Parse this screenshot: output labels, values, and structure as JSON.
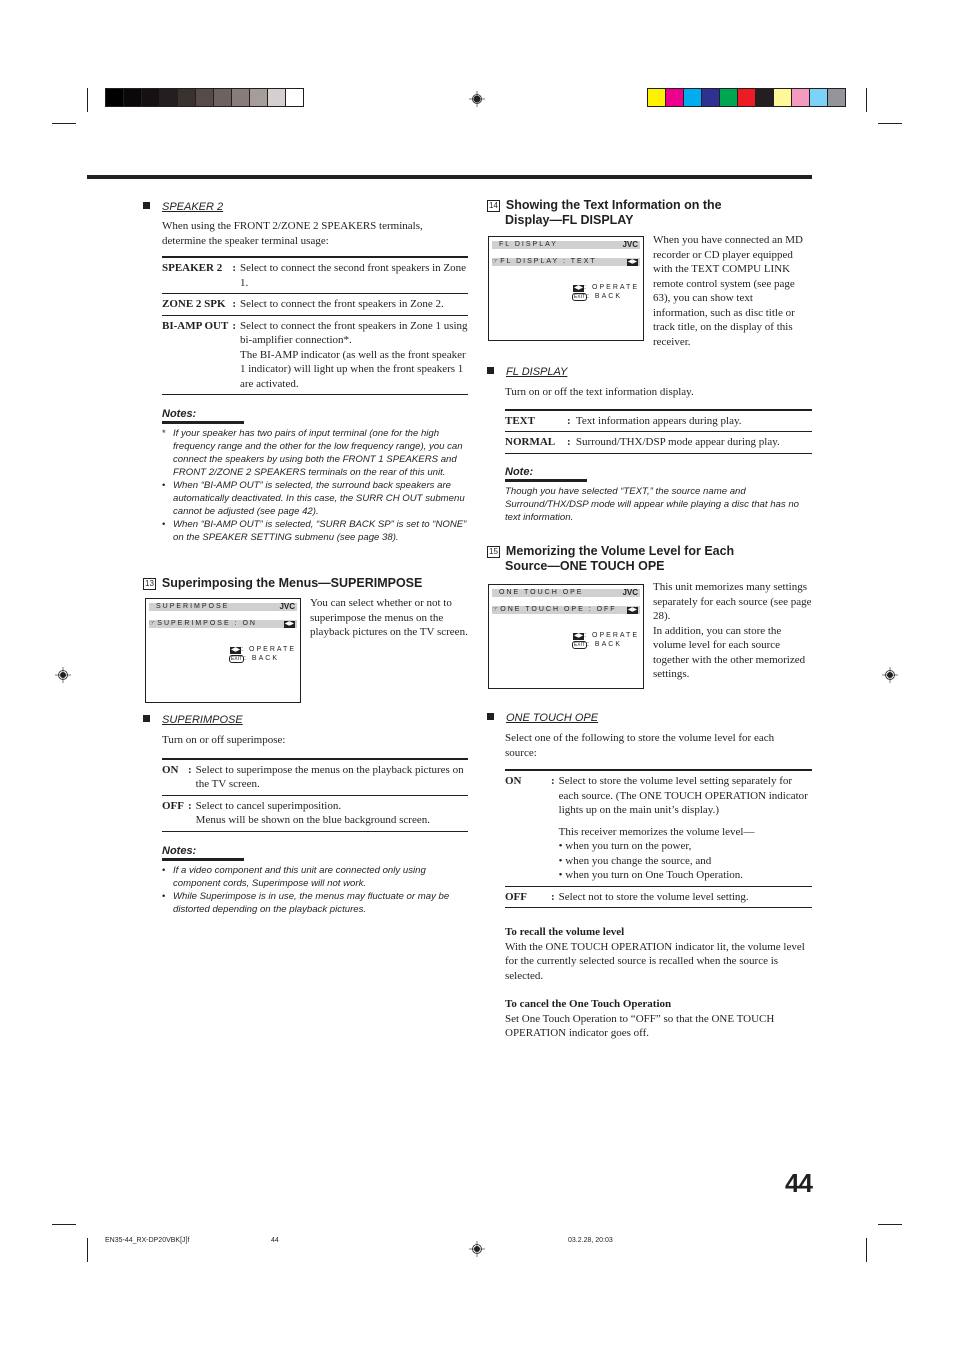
{
  "color_bars": {
    "grayscale": [
      "#000000",
      "#0a0808",
      "#141110",
      "#231f20",
      "#3a3230",
      "#564b48",
      "#6d625f",
      "#877c7a",
      "#a59d9c",
      "#d6cfcf",
      "#ffffff"
    ],
    "process": [
      "#fff200",
      "#ec008c",
      "#00aeef",
      "#2e3192",
      "#00a651",
      "#ed1c24",
      "#231f20",
      "#fff799",
      "#f49ac1",
      "#7dd3f7",
      "#939598"
    ]
  },
  "left": {
    "speaker2": {
      "title": "SPEAKER 2",
      "intro": "When using the FRONT 2/ZONE 2 SPEAKERS terminals, determine the speaker terminal usage:",
      "options": [
        {
          "key": "SPEAKER 2",
          "desc": "Select to connect the second front speakers in Zone 1."
        },
        {
          "key": "ZONE 2 SPK",
          "desc": "Select to connect the front speakers in Zone 2."
        },
        {
          "key": "BI-AMP OUT",
          "desc": "Select to connect the front speakers in Zone 1 using bi-amplifier connection*.",
          "desc2": "The BI-AMP indicator (as well as the front speaker 1 indicator) will light up when the front speakers 1 are activated."
        }
      ],
      "notes_title": "Notes:",
      "notes": [
        {
          "mark": "*",
          "text": "If your speaker has two pairs of input terminal (one for the high frequency range and the other for the low frequency range), you can connect the speakers by using both the FRONT 1 SPEAKERS and FRONT 2/ZONE 2 SPEAKERS terminals on the rear of this unit."
        },
        {
          "mark": "•",
          "text": "When “BI-AMP OUT” is selected, the surround back speakers are automatically deactivated. In this case, the SURR CH OUT submenu cannot be adjusted (see page 42)."
        },
        {
          "mark": "•",
          "text": "When “BI-AMP OUT” is selected, “SURR BACK SP” is set to “NONE” on the SPEAKER SETTING submenu (see page 38)."
        }
      ]
    },
    "superimpose_section": {
      "number": "13",
      "heading": "Superimposing the Menus—SUPERIMPOSE",
      "screen": {
        "title": "SUPERIMPOSE",
        "brand": "JVC",
        "line": "☞SUPERIMPOSE  :  ON",
        "arrows": "◀▶",
        "operate": ": OPERATE",
        "back": ": BACK",
        "exit": "EXIT"
      },
      "description": "You can select whether or not to superimpose the menus on the playback pictures on the TV screen.",
      "sub_title": "SUPERIMPOSE",
      "intro": "Turn on or off superimpose:",
      "options": [
        {
          "key": "ON",
          "desc": "Select to superimpose the menus on the playback pictures on the TV screen."
        },
        {
          "key": "OFF",
          "desc": "Select to cancel superimposition.",
          "desc2": "Menus will be shown on the blue background screen."
        }
      ],
      "notes_title": "Notes:",
      "notes": [
        {
          "mark": "•",
          "text": "If a video component and this unit are connected only using component cords, Superimpose will not work."
        },
        {
          "mark": "•",
          "text": "While Superimpose is in use, the menus may fluctuate or may be distorted depending on the playback pictures."
        }
      ]
    }
  },
  "right": {
    "fl_section": {
      "number": "14",
      "heading_line1": "Showing the Text Information on the",
      "heading_line2": "Display—FL DISPLAY",
      "screen": {
        "title": "FL  DISPLAY",
        "brand": "JVC",
        "line": "☞FL  DISPLAY  :  TEXT",
        "arrows": "◀▶",
        "operate": ": OPERATE",
        "back": ": BACK",
        "exit": "EXIT"
      },
      "description": "When you have connected an MD recorder or CD player equipped with the TEXT COMPU LINK remote control system (see page 63), you can show text information, such as disc title or track title, on the display of this receiver.",
      "sub_title": "FL DISPLAY",
      "intro": "Turn on or off the text information display.",
      "options": [
        {
          "key": "TEXT",
          "desc": "Text information appears during play."
        },
        {
          "key": "NORMAL",
          "desc": "Surround/THX/DSP mode appear during play."
        }
      ],
      "note_title": "Note:",
      "note": "Though you have selected “TEXT,”  the source name and Surround/THX/DSP mode will appear while playing a disc that has no text information."
    },
    "one_touch_section": {
      "number": "15",
      "heading_line1": "Memorizing the Volume Level for Each",
      "heading_line2": "Source—ONE TOUCH OPE",
      "screen": {
        "title": "ONE  TOUCH  OPE",
        "brand": "JVC",
        "line": "☞ONE  TOUCH  OPE  :  OFF",
        "arrows": "◀▶",
        "operate": ": OPERATE",
        "back": ": BACK",
        "exit": "EXIT"
      },
      "description1": "This unit memorizes many settings separately for each source (see page 28).",
      "description2": "In addition, you can store the volume level for each source together with the other memorized settings.",
      "sub_title": "ONE TOUCH OPE",
      "intro": "Select one of the following to store the volume level for each source:",
      "options": [
        {
          "key": "ON",
          "desc": "Select to store the volume level setting separately for each source. (The ONE TOUCH OPERATION indicator lights up on the main unit’s display.)",
          "extra": "This receiver memorizes the volume level—",
          "bullets": [
            "when you turn on the power,",
            "when you change the source, and",
            "when you turn on One Touch Operation."
          ]
        },
        {
          "key": "OFF",
          "desc": "Select not to store the volume level setting."
        }
      ],
      "recall_title": "To recall the volume level",
      "recall_text": "With the ONE TOUCH OPERATION indicator lit, the volume level for the currently selected source is recalled when the source is selected.",
      "cancel_title": "To cancel the One Touch Operation",
      "cancel_text": "Set One Touch Operation to “OFF” so that the ONE TOUCH OPERATION indicator goes off."
    }
  },
  "page_number": "44",
  "footer": {
    "file": "EN35-44_RX-DP20VBK[J]f",
    "page": "44",
    "timestamp": "03.2.28, 20:03"
  }
}
